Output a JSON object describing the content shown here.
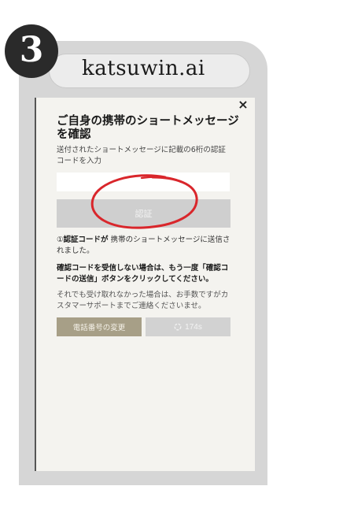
{
  "step_number": "3",
  "browser": {
    "url": "katsuwin.ai"
  },
  "dialog": {
    "close_label": "×",
    "title": "ご自身の携帯のショートメッセージを確認",
    "instruction": "送付されたショートメッセージに記載の6桁の認証コードを入力",
    "code_input": {
      "value": "",
      "placeholder": ""
    },
    "verify_label": "認証",
    "notice_prefix": "①",
    "notice_bold": "認証コードが",
    "notice_rest": " 携帯のショートメッセージに送信されました。",
    "note_bold": "確認コードを受信しない場合は、もう一度「確認コードの送信」ボタンをクリックしてください。",
    "note_plain": "それでも受け取れなかった場合は、お手数ですがカスタマーサポートまでご連絡くださいませ。",
    "change_phone_label": "電話番号の変更",
    "timer_icon": "spinner-icon",
    "resend_timer": "174s"
  },
  "colors": {
    "frame": "#d6d6d6",
    "screen_bg": "#f4f3ef",
    "verify_button": "#cfcfcf",
    "change_phone_button": "#a79f87",
    "annotation_red": "#d9262b"
  }
}
